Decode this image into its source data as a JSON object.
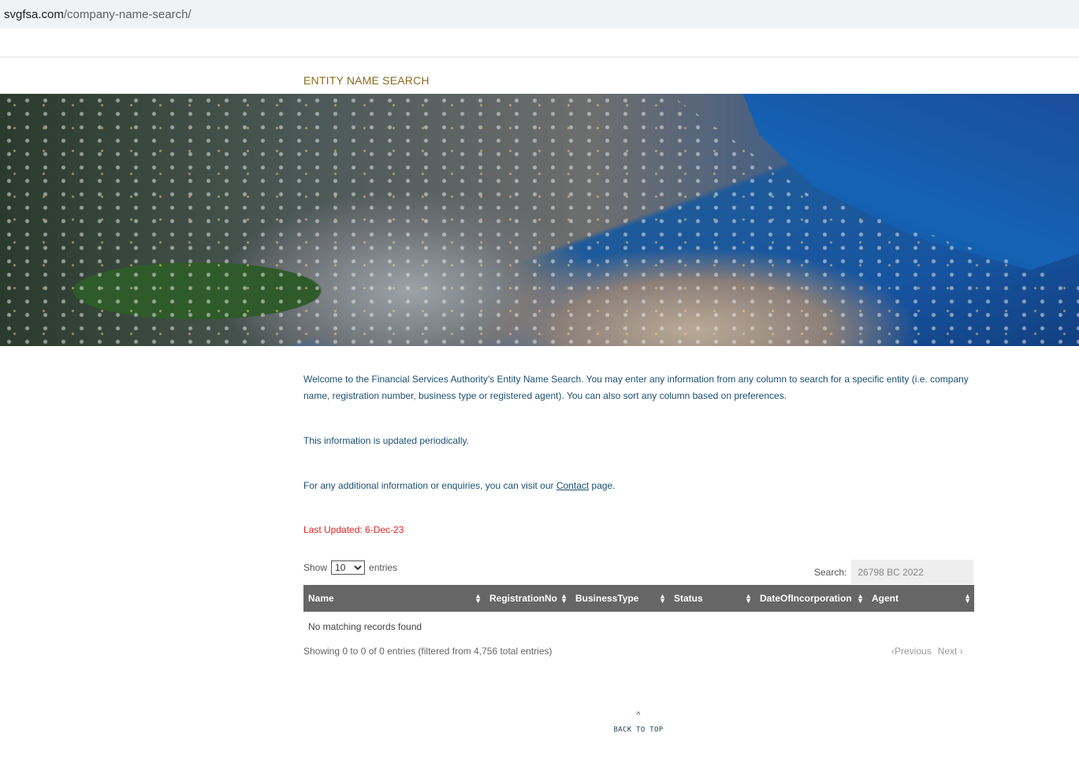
{
  "browser": {
    "url_host": "svgfsa.com",
    "url_path": "/company-name-search/"
  },
  "page": {
    "title": "ENTITY NAME SEARCH"
  },
  "intro": {
    "welcome": "Welcome to the Financial Services Authority's Entity Name Search. You may enter any information from any column to search for a specific entity (i.e. company name, registration number, business type or registered agent). You can also sort any column based on preferences.",
    "updated_note": "This information is updated periodically.",
    "contact_prefix": "For any additional information or enquiries, you can visit our ",
    "contact_link": "Contact",
    "contact_suffix": " page.",
    "last_updated": "Last Updated:  6-Dec-23"
  },
  "table_controls": {
    "show_label": "Show",
    "entries_label": "entries",
    "page_size": "10",
    "search_label": "Search:",
    "search_value": "26798 BC 2022"
  },
  "table": {
    "columns": [
      "Name",
      "RegistrationNo",
      "BusinessType",
      "Status",
      "DateOfIncorporation",
      "Agent"
    ],
    "empty": "No matching records found"
  },
  "footer_info": {
    "showing": "Showing 0 to 0 of 0 entries (filtered from 4,756 total entries)",
    "previous": "Previous",
    "next": "Next"
  },
  "back_to_top": "BACK TO TOP"
}
